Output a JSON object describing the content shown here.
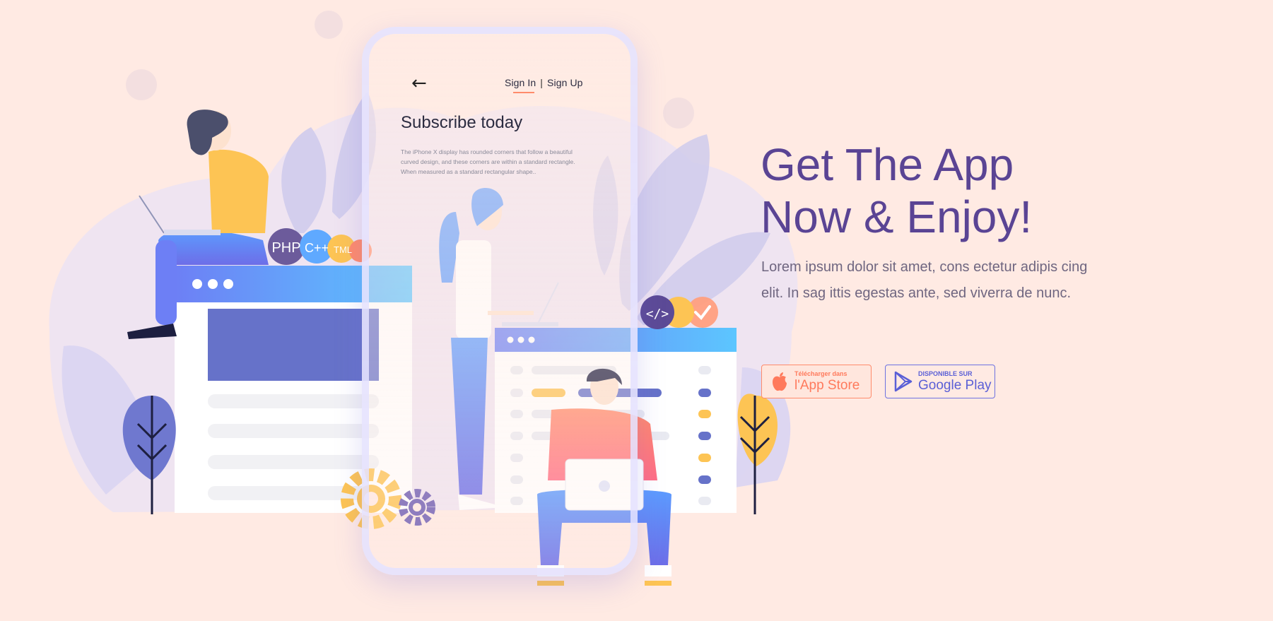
{
  "phone_screen": {
    "back_icon": "arrow-left-icon",
    "sign_in_label": "Sign In",
    "separator": "|",
    "sign_up_label": "Sign Up",
    "title": "Subscribe today",
    "description": "The iPhone X display has rounded corners that follow a beautiful curved design, and these corners are within a standard rectangle. When measured as a standard rectangular shape.."
  },
  "illustration": {
    "badges": [
      "PHP",
      "C++",
      "TML"
    ],
    "code_icon": "code-brackets-icon",
    "check_icon": "check-icon"
  },
  "hero": {
    "title_line1": "Get The App",
    "title_line2": "Now & Enjoy!",
    "description": "Lorem ipsum dolor sit amet, cons ectetur adipis cing elit. In sag ittis egestas ante, sed viverra de nunc."
  },
  "store_buttons": {
    "app_store": {
      "small": "Télécharger dans",
      "big": "l'App Store",
      "icon": "apple-icon"
    },
    "google_play": {
      "small": "DISPONIBLE SUR",
      "big": "Google Play",
      "icon": "play-store-icon"
    }
  },
  "colors": {
    "background": "#ffeae3",
    "title": "#5a4494",
    "accent_orange": "#ff8b6b",
    "accent_blue": "#5a5fd6",
    "yellow": "#fdc454"
  }
}
